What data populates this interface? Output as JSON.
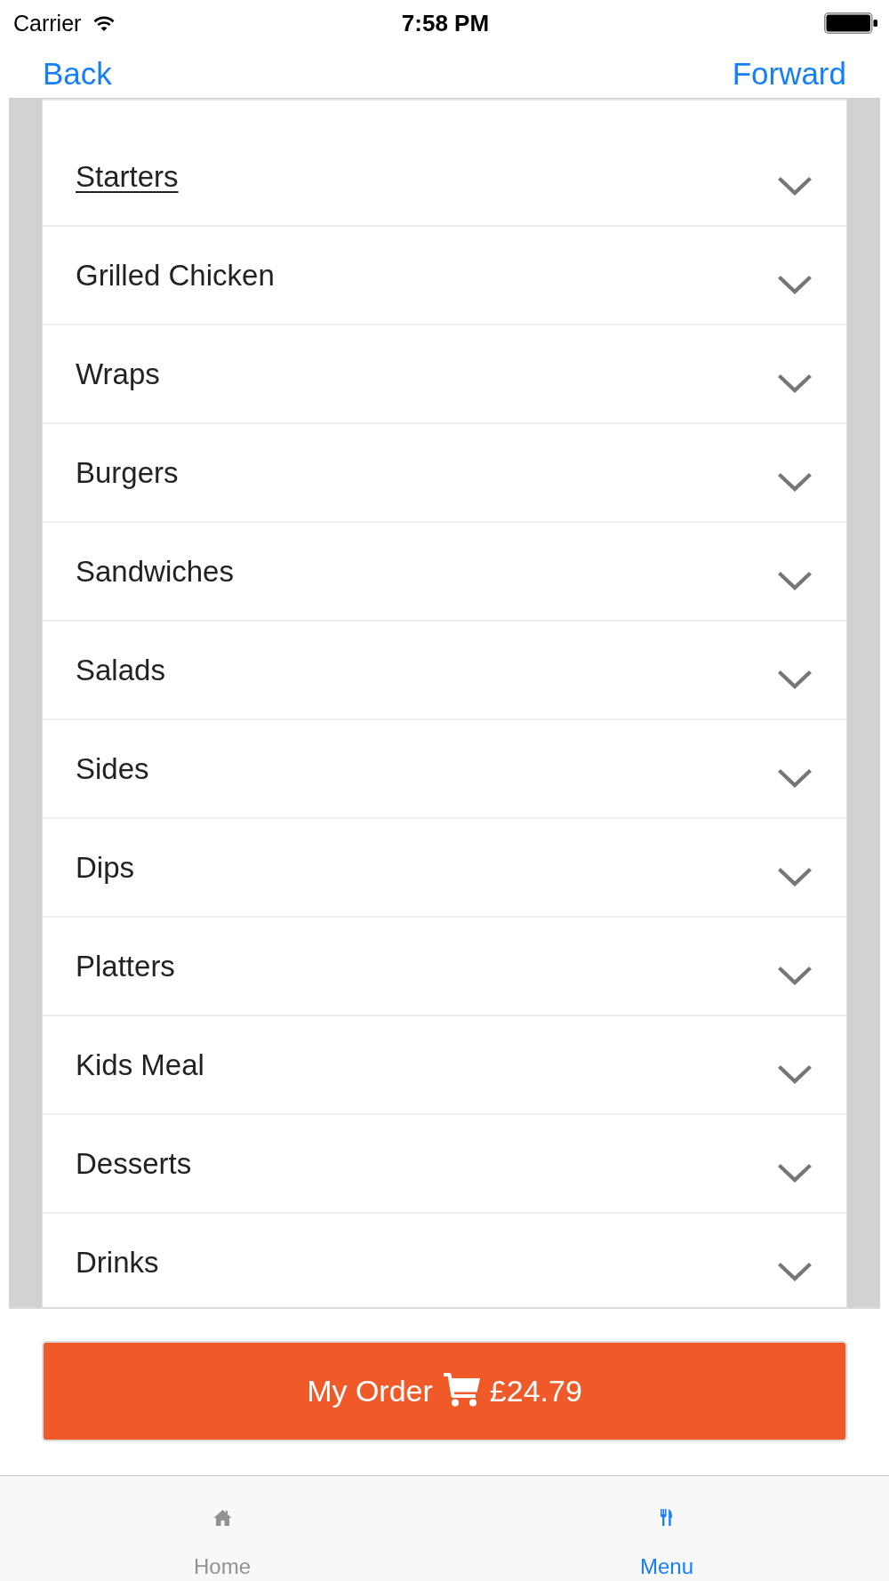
{
  "status_bar": {
    "carrier": "Carrier",
    "time": "7:58 PM"
  },
  "nav": {
    "back": "Back",
    "forward": "Forward"
  },
  "categories": [
    {
      "label": "Starters",
      "selected": true,
      "expanded": false
    },
    {
      "label": "Grilled Chicken",
      "selected": false,
      "expanded": false
    },
    {
      "label": "Wraps",
      "selected": false,
      "expanded": false
    },
    {
      "label": "Burgers",
      "selected": false,
      "expanded": false
    },
    {
      "label": "Sandwiches",
      "selected": false,
      "expanded": false
    },
    {
      "label": "Salads",
      "selected": false,
      "expanded": false
    },
    {
      "label": "Sides",
      "selected": false,
      "expanded": false
    },
    {
      "label": "Dips",
      "selected": false,
      "expanded": false
    },
    {
      "label": "Platters",
      "selected": false,
      "expanded": false
    },
    {
      "label": "Kids Meal",
      "selected": false,
      "expanded": false
    },
    {
      "label": "Desserts",
      "selected": false,
      "expanded": false
    },
    {
      "label": "Drinks",
      "selected": false,
      "expanded": false
    }
  ],
  "order_button": {
    "label": "My Order",
    "total": "£24.79"
  },
  "tab_bar": [
    {
      "label": "Home",
      "selected": false
    },
    {
      "label": "Menu",
      "selected": true
    }
  ]
}
